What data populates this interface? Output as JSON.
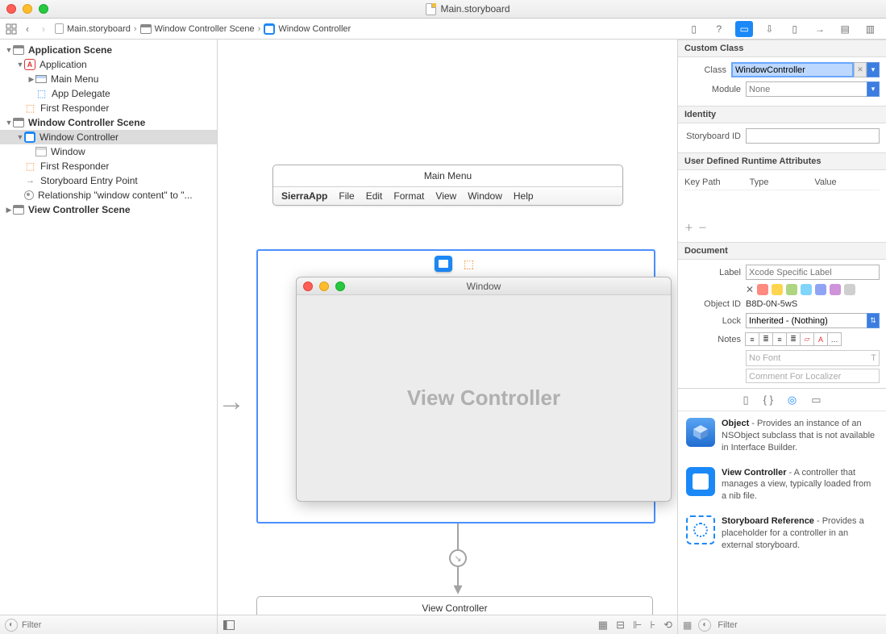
{
  "titlebar": {
    "filename": "Main.storyboard"
  },
  "breadcrumb": {
    "file": "Main.storyboard",
    "scene": "Window Controller Scene",
    "controller": "Window Controller"
  },
  "outline": {
    "appScene": "Application Scene",
    "application": "Application",
    "mainMenu": "Main Menu",
    "appDelegate": "App Delegate",
    "firstResponder": "First Responder",
    "wcScene": "Window Controller Scene",
    "windowController": "Window Controller",
    "window": "Window",
    "entryPoint": "Storyboard Entry Point",
    "relationship": "Relationship \"window content\" to \"...",
    "vcScene": "View Controller Scene"
  },
  "canvas": {
    "menuTitle": "Main Menu",
    "menuItems": [
      "SierraApp",
      "File",
      "Edit",
      "Format",
      "View",
      "Window",
      "Help"
    ],
    "windowLabel": "Window",
    "vcLabel": "View Controller",
    "vcBlockLabel": "View Controller"
  },
  "inspector": {
    "sections": {
      "customClass": "Custom Class",
      "identity": "Identity",
      "uda": "User Defined Runtime Attributes",
      "document": "Document"
    },
    "classLabel": "Class",
    "classValue": "WindowController",
    "moduleLabel": "Module",
    "moduleValue": "None",
    "sbIdLabel": "Storyboard ID",
    "sbIdValue": "",
    "attrHeaders": {
      "keyPath": "Key Path",
      "type": "Type",
      "value": "Value"
    },
    "docLabel": "Label",
    "docLabelPlaceholder": "Xcode Specific Label",
    "objectIdLabel": "Object ID",
    "objectIdValue": "B8D-0N-5wS",
    "lockLabel": "Lock",
    "lockValue": "Inherited - (Nothing)",
    "notesLabel": "Notes",
    "noFont": "No Font",
    "commentPlaceholder": "Comment For Localizer",
    "colors": [
      "#ff5f57",
      "#ffd24a",
      "#8fe04a",
      "#5ad1e6",
      "#6aa7ff",
      "#c79bff",
      "#cfcfcf"
    ]
  },
  "library": {
    "items": [
      {
        "title": "Object",
        "desc": " - Provides an instance of an NSObject subclass that is not available in Interface Builder."
      },
      {
        "title": "View Controller",
        "desc": " - A controller that manages a view, typically loaded from a nib file."
      },
      {
        "title": "Storyboard Reference",
        "desc": " - Provides a placeholder for a controller in an external storyboard."
      }
    ],
    "filterPlaceholder": "Filter"
  },
  "filterPlaceholder": "Filter"
}
